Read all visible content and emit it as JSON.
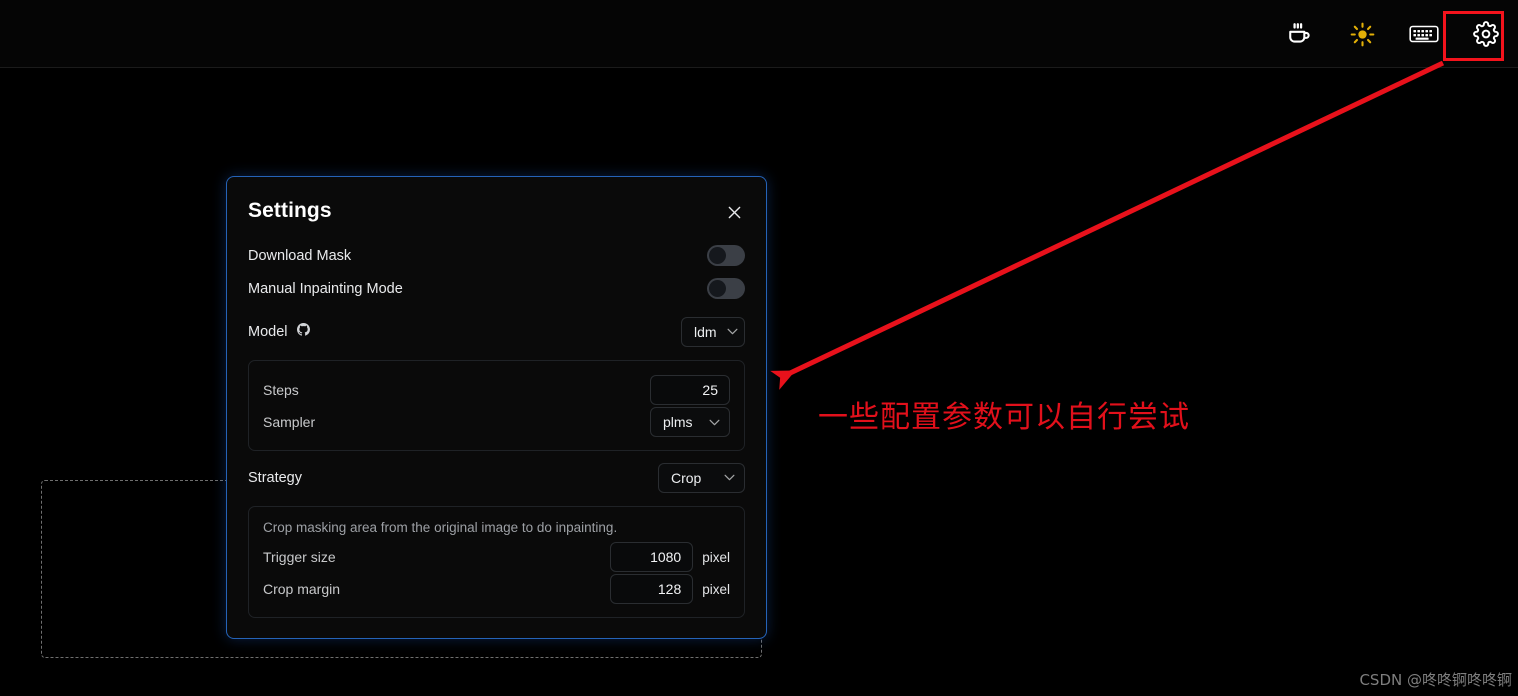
{
  "topbar": {
    "icons": [
      {
        "name": "coffee-icon",
        "label": "Buy me a coffee"
      },
      {
        "name": "brightness-icon",
        "label": "Theme"
      },
      {
        "name": "keyboard-icon",
        "label": "Shortcuts"
      },
      {
        "name": "gear-icon",
        "label": "Settings"
      }
    ],
    "highlight_color": "#f4131c",
    "brightness_color": "#e3b007"
  },
  "dialog": {
    "title": "Settings",
    "close_label": "×",
    "rows": {
      "download_mask": {
        "label": "Download Mask",
        "value": "off"
      },
      "manual_inpainting": {
        "label": "Manual Inpainting Mode",
        "value": "off"
      },
      "model": {
        "label": "Model",
        "icon": "github-icon",
        "selected": "ldm"
      },
      "steps": {
        "label": "Steps",
        "value": "25"
      },
      "sampler": {
        "label": "Sampler",
        "selected": "plms"
      },
      "strategy": {
        "label": "Strategy",
        "selected": "Crop"
      },
      "crop_desc": "Crop masking area from the original image to do inpainting.",
      "trigger_size": {
        "label": "Trigger size",
        "value": "1080",
        "unit": "pixel"
      },
      "crop_margin": {
        "label": "Crop margin",
        "value": "128",
        "unit": "pixel"
      }
    }
  },
  "annotation": {
    "text": "一些配置参数可以自行尝试",
    "color": "#e2101b"
  },
  "watermark": {
    "text": "CSDN @咚咚锕咚咚锕"
  }
}
